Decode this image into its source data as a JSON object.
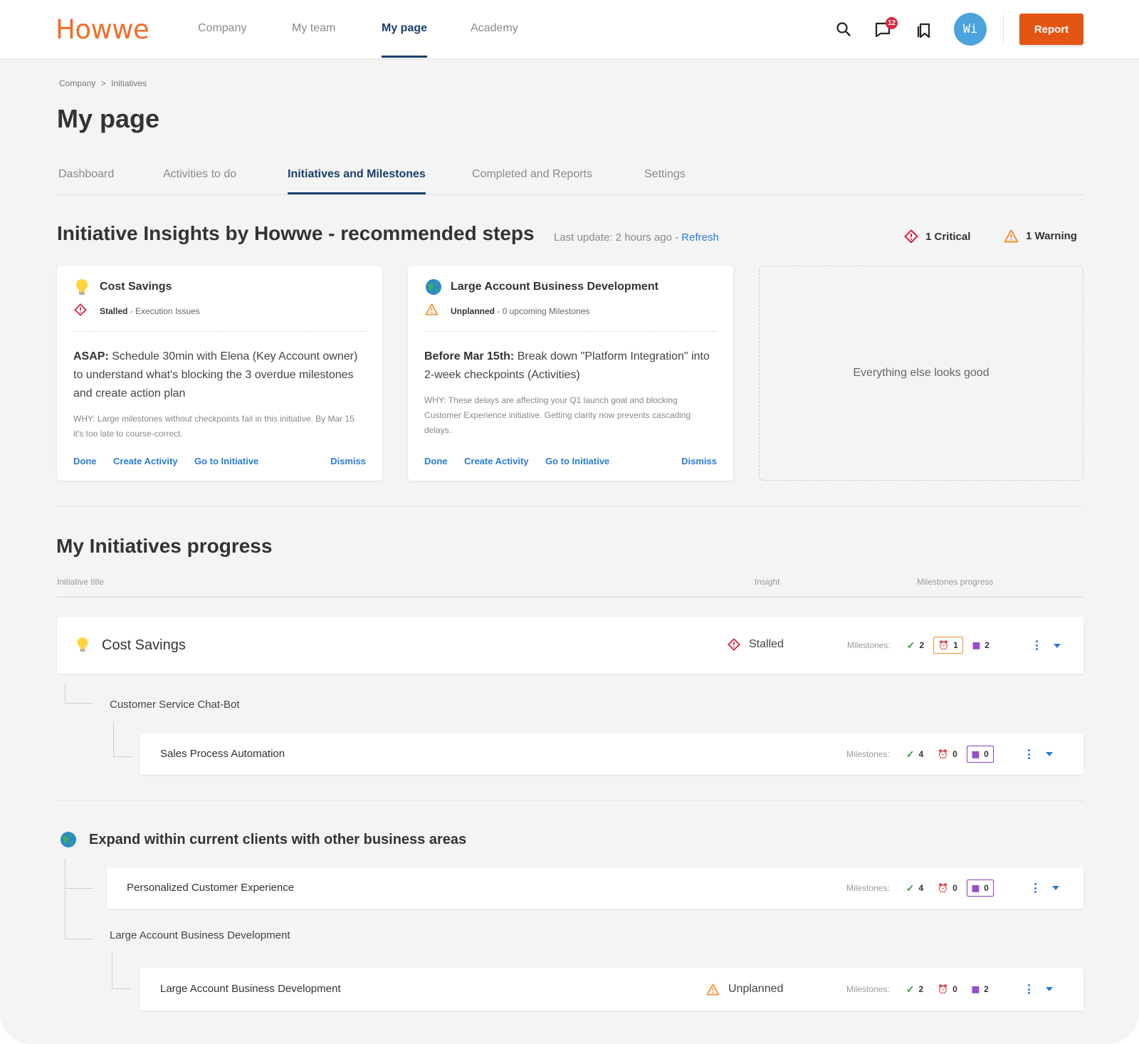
{
  "nav": {
    "logo": "Howwe",
    "links": [
      "Company",
      "My team",
      "My page",
      "Academy"
    ],
    "active": "My page",
    "notification_count": "12",
    "avatar_initials": "Wi",
    "report_label": "Report"
  },
  "breadcrumb": {
    "parent": "Company",
    "separator": ">",
    "current": "Initiatives"
  },
  "page_title": "My page",
  "tabs": [
    "Dashboard",
    "Activities to do",
    "Initiatives and Milestones",
    "Completed and Reports",
    "Settings"
  ],
  "active_tab": "Initiatives and Milestones",
  "insights": {
    "title": "Initiative Insights by Howwe - recommended steps",
    "last_update": "Last update: 2 hours ago -",
    "refresh": "Refresh",
    "critical": "1 Critical",
    "warning": "1 Warning",
    "cards": [
      {
        "title": "Cost Savings",
        "icon": "lightbulb-icon",
        "status": "Stalled",
        "status_detail": "- Execution Issues",
        "action_lead": "ASAP:",
        "action": "Schedule 30min with Elena (Key Account owner) to understand what's blocking the 3 overdue milestones and create action plan",
        "why": "WHY: Large milestones without checkpoints fail in this initiative. By Mar 15 it's too late to course-correct.",
        "links": [
          "Done",
          "Create Activity",
          "Go to Initiative",
          "Dismiss"
        ]
      },
      {
        "title": "Large Account Business Development",
        "icon": "globe-icon",
        "status": "Unplanned",
        "status_detail": "- 0 upcoming Milestones",
        "action_lead": "Before Mar 15th:",
        "action": "Break down \"Platform Integration\" into 2-week checkpoints (Activities)",
        "why": "WHY: These delays are affecting your Q1 launch goal and blocking Customer Experience initiative. Getting clarity now prevents cascading delays.",
        "links": [
          "Done",
          "Create Activity",
          "Go to Initiative",
          "Dismiss"
        ]
      }
    ],
    "all_good": "Everything else looks good"
  },
  "progress": {
    "title": "My Initiatives progress",
    "columns": {
      "title": "Initiative title",
      "insight": "Insight",
      "milestones": "Milestones progress"
    },
    "milestones_label": "Milestones:",
    "rows": [
      {
        "title": "Cost Savings",
        "insight": "Stalled",
        "done": "2",
        "overdue": "1",
        "planned": "2"
      },
      {
        "title": "Sales Process Automation",
        "done": "4",
        "overdue": "0",
        "planned": "0"
      },
      {
        "title": "Personalized Customer Experience",
        "done": "4",
        "overdue": "0",
        "planned": "0"
      },
      {
        "title": "Large Account Business Development",
        "insight": "Unplanned",
        "done": "2",
        "overdue": "0",
        "planned": "2"
      }
    ],
    "groups": {
      "chatbot": "Customer Service Chat-Bot",
      "expand": "Expand within current clients with other business areas",
      "large_account": "Large Account Business Development"
    }
  },
  "colors": {
    "accent": "#e45513",
    "nav_active": "#1b3f6e",
    "link": "#2a7bd8",
    "critical": "#d7263d",
    "warning": "#f39232",
    "planned": "#8a3ac4",
    "done": "#2f9e44"
  }
}
